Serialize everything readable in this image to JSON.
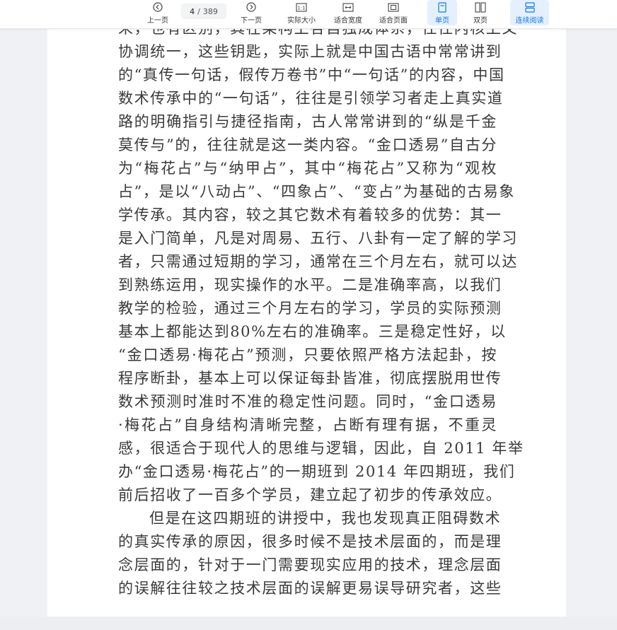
{
  "toolbar": {
    "prev_label": "上一页",
    "next_label": "下一页",
    "page_current": "4",
    "page_sep": "/",
    "page_total": "389",
    "actual_size_label": "实际大小",
    "fit_width_label": "适合宽度",
    "fit_page_label": "适合页面",
    "single_page_label": "单页",
    "double_page_label": "双页",
    "continuous_label": "连续阅读",
    "accent_color": "#1677e8"
  },
  "document": {
    "lines": [
      "来，也有区别，其在某构上各自独成体系，往往内核上又",
      "协调统一，这些钥匙，实际上就是中国古语中常常讲到",
      "的“真传一句话，假传万卷书”中“一句话”的内容，中国",
      "数术传承中的“一句话”，往往是引领学习者走上真实道",
      "路的明确指引与捷径指南，古人常常讲到的“纵是千金",
      "莫传与”的，往往就是这一类内容。“金口透易”自古分",
      "为“梅花占”与“纳甲占”，其中“梅花占”又称为“观枚",
      "占”，是以“八动占”、“四象占”、“变占”为基础的古易象",
      "学传承。其内容，较之其它数术有着较多的优势：其一",
      "是入门简单，凡是对周易、五行、八卦有一定了解的学习",
      "者，只需通过短期的学习，通常在三个月左右，就可以达",
      "到熟练运用，现实操作的水平。二是准确率高，以我们",
      "教学的检验，通过三个月左右的学习，学员的实际预测",
      "基本上都能达到80%左右的准确率。三是稳定性好，以",
      "“金口透易·梅花占”预测，只要依照严格方法起卦，按",
      "程序断卦，基本上可以保证每卦皆准，彻底摆脱用世传",
      "数术预测时准时不准的稳定性问题。同时，“金口透易",
      "·梅花占”自身结构清晰完整，占断有理有据，不重灵",
      "感，很适合于现代人的思维与逻辑，因此，自 2011 年举",
      "办“金口透易·梅花占”的一期班到 2014 年四期班，我们",
      "前后招收了一百多个学员，建立起了初步的传承效应。",
      "但是在这四期班的讲授中，我也发现真正阻碍数术",
      "的真实传承的原因，很多时候不是技术层面的，而是理",
      "念层面的，针对于一门需要现实应用的技术，理念层面",
      "的误解往往较之技术层面的误解更易误导研究者，这些"
    ]
  }
}
